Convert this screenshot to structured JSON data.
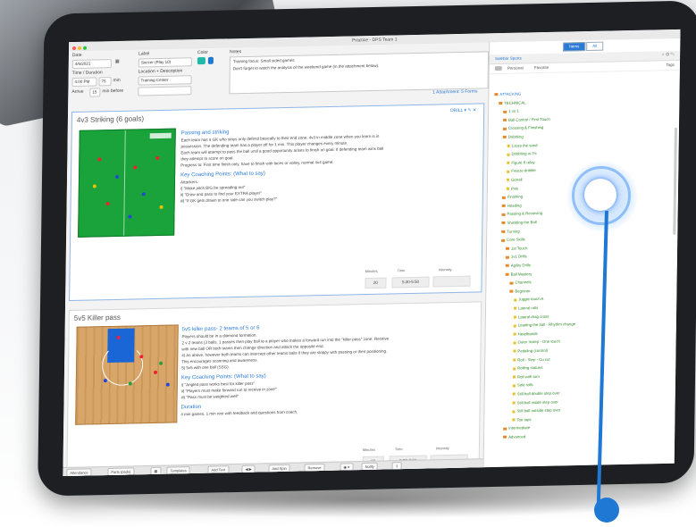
{
  "window": {
    "title": "Practice - DPS Team 1"
  },
  "form": {
    "date_label": "Date",
    "date_value": "4/6/2021",
    "label_label": "Label",
    "label_value": "Soccer (Play 10)",
    "color_label": "Color",
    "notes_label": "Notes",
    "time_label": "Time / Duration",
    "time_value": "4:00 PM",
    "duration_value": "75",
    "duration_unit": "min",
    "location_label": "Location + Description",
    "location_value": "Training Center",
    "arrive_label": "Arrive",
    "arrive_value": "15",
    "arrive_unit": "min before",
    "notes_line1": "Training focus: Small sided games",
    "notes_line2": "Don't forget to watch the analysis of the weekend game (in the attachment below).",
    "attachments": "1 Attachment: 5 Forms"
  },
  "drills": [
    {
      "title": "4v3 Striking (6 goals)",
      "header_link": "DRILL",
      "section1": "Passing and striking",
      "body": [
        "Each team has a GK who stays only defend basically to their end zone. 4v3 in middle zone when you learn is in",
        "possession. The defending team has a player off for 1 min. This player changes every minute.",
        "Each team will attempt to pass the ball until a good opportunity arises to finish on goal. If defending team wins ball",
        "they attempt to score on goal.",
        "Progress to: First time finish only, have to finish with laces or volley, normal 4v4 game."
      ],
      "section2": "Key Coaching Points: (What to say)",
      "points": [
        "Attackers:",
        "i) \"Make pitch BIG be spreading out\"",
        "ii) \"Draw and pass to find your EXTRA player\"",
        "iii) \"If GK gets drawn to one side can you switch play?\""
      ],
      "stats_headers": [
        "Minutes",
        "Time",
        "Intensity"
      ],
      "stats_values": [
        "20",
        "5:30-5:50",
        ""
      ]
    },
    {
      "title": "5v5 Killer pass",
      "section1": "5v5 killer pass- 2 teams of 5 or 6",
      "body": [
        "Players should be in a diamond formation.",
        "2 v 2 teams (3 balls. 1 passes then play ball to a player who makes a forward run into the \"killer pass\" zone. Receive",
        "with new ball OR both teams then change direction and attack the opposite end.",
        "4) As above, however both teams can intercept other teams balls if they are sloppy with passing or their positioning.",
        "This encourages scanning and awareness.",
        "5) 5v5 with one ball (SSG)."
      ],
      "section2": "Key Coaching Points: (What to say)",
      "points": [
        "i) \"Angled pass works best for killer pass\"",
        "ii) \"Players must make forward run to receive in zone\"",
        "iii) \"Pass must be weighted well\""
      ],
      "section3": "Duration",
      "duration_text": "4 min games, 1 min rest with feedback and questions from coach.",
      "stats_headers": [
        "Minutes",
        "Time",
        "Intensity"
      ],
      "stats_values": [
        "20",
        "6:00-7:20",
        ""
      ]
    }
  ],
  "toolbar": {
    "buttons": [
      "Attendance",
      "Parts (pads)",
      "Templates",
      "Add Text",
      "Add Spin",
      "Remove",
      "Notify"
    ]
  },
  "sidebar": {
    "seg": [
      "Items",
      "All"
    ],
    "tab": "Sidebar Sports",
    "filters": [
      "Personal",
      "Favorite"
    ],
    "tag_label": "Tags",
    "tree": [
      {
        "level": 0,
        "kind": "folder",
        "label": "ATTACKING"
      },
      {
        "level": 1,
        "kind": "folder",
        "label": "TECHNICAL"
      },
      {
        "level": 2,
        "kind": "folder",
        "label": "1 vs 1"
      },
      {
        "level": 2,
        "kind": "folder",
        "label": "Ball Control / First Touch"
      },
      {
        "level": 2,
        "kind": "folder",
        "label": "Crossing & Finishing"
      },
      {
        "level": 2,
        "kind": "folder",
        "label": "Dribbling"
      },
      {
        "level": 3,
        "kind": "drill",
        "label": "Cross the sand"
      },
      {
        "level": 3,
        "kind": "drill",
        "label": "Dribbling in 3's"
      },
      {
        "level": 3,
        "kind": "drill",
        "label": "Figure 8 relay"
      },
      {
        "level": 3,
        "kind": "drill",
        "label": "Freeze dribble"
      },
      {
        "level": 3,
        "kind": "drill",
        "label": "Gonall"
      },
      {
        "level": 3,
        "kind": "drill",
        "label": "Pink"
      },
      {
        "level": 2,
        "kind": "folder",
        "label": "Finishing"
      },
      {
        "level": 2,
        "kind": "folder",
        "label": "Heading"
      },
      {
        "level": 2,
        "kind": "folder",
        "label": "Passing & Receiving"
      },
      {
        "level": 2,
        "kind": "folder",
        "label": "Shielding the Ball"
      },
      {
        "level": 2,
        "kind": "folder",
        "label": "Turning"
      },
      {
        "level": 2,
        "kind": "folder",
        "label": "Core Skills"
      },
      {
        "level": 3,
        "kind": "folder",
        "label": "1st Touch"
      },
      {
        "level": 3,
        "kind": "folder",
        "label": "1v1 Drills"
      },
      {
        "level": 3,
        "kind": "folder",
        "label": "Agility Drills"
      },
      {
        "level": 3,
        "kind": "folder",
        "label": "Ball Mastery"
      },
      {
        "level": 4,
        "kind": "folder",
        "label": "Channels"
      },
      {
        "level": 4,
        "kind": "folder",
        "label": "Beginner"
      },
      {
        "level": 5,
        "kind": "drill",
        "label": "Juggle touch A"
      },
      {
        "level": 5,
        "kind": "drill",
        "label": "Lateral rolls"
      },
      {
        "level": 5,
        "kind": "drill",
        "label": "Lateral drag cross"
      },
      {
        "level": 5,
        "kind": "drill",
        "label": "Leading the ball - Rhythm change"
      },
      {
        "level": 5,
        "kind": "drill",
        "label": "Headbands"
      },
      {
        "level": 5,
        "kind": "drill",
        "label": "Outer Instep - One touch"
      },
      {
        "level": 5,
        "kind": "drill",
        "label": "Pedaling (control)"
      },
      {
        "level": 5,
        "kind": "drill",
        "label": "Roll - Step - Cu cut"
      },
      {
        "level": 5,
        "kind": "drill",
        "label": "Rolling statues"
      },
      {
        "level": 5,
        "kind": "drill",
        "label": "Roll with turn"
      },
      {
        "level": 5,
        "kind": "drill",
        "label": "Sole rolls"
      },
      {
        "level": 5,
        "kind": "drill",
        "label": "Still ball double step over"
      },
      {
        "level": 5,
        "kind": "drill",
        "label": "Still ball inside step over"
      },
      {
        "level": 5,
        "kind": "drill",
        "label": "Still ball outside step over"
      },
      {
        "level": 5,
        "kind": "drill",
        "label": "Toe taps"
      },
      {
        "level": 3,
        "kind": "folder",
        "label": "Intermediate"
      },
      {
        "level": 3,
        "kind": "folder",
        "label": "Advanced"
      }
    ]
  },
  "colors": {
    "accent": "#2a7bd6",
    "folder": "#e58b2d",
    "tree_text": "#2f8a2a",
    "pitch": "#19a33a",
    "court": "#d9a66a"
  }
}
